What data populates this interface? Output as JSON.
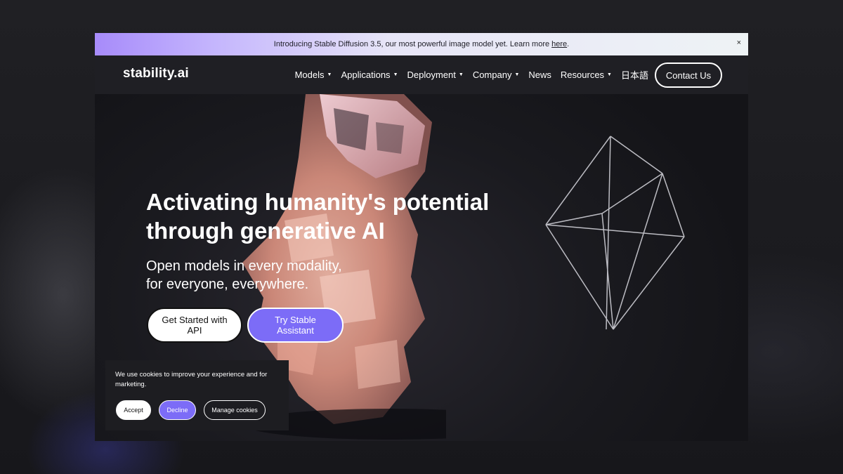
{
  "announcement": {
    "text": "Introducing Stable Diffusion 3.5, our most powerful image model yet. Learn more",
    "link": "here",
    "period": ".",
    "close": "×"
  },
  "nav": {
    "logo": "stability.ai",
    "items": [
      {
        "label": "Models",
        "caret": "▼"
      },
      {
        "label": "Applications",
        "caret": "▼"
      },
      {
        "label": "Deployment",
        "caret": "▼"
      },
      {
        "label": "Company",
        "caret": "▼"
      },
      {
        "label": "News",
        "caret": ""
      },
      {
        "label": "Resources",
        "caret": "▼"
      },
      {
        "label": "日本語",
        "caret": ""
      }
    ],
    "contact": "Contact Us"
  },
  "hero": {
    "title": "Activating humanity's potential through generative AI",
    "subtitle_line1": "Open models in every modality,",
    "subtitle_line2": "for everyone, everywhere.",
    "cta_api": "Get Started with API",
    "cta_assistant": "Try Stable Assistant"
  },
  "cookie": {
    "text": "We use cookies to improve your experience and for marketing.",
    "accept": "Accept",
    "decline": "Decline",
    "manage": "Manage cookies"
  },
  "colors": {
    "accent": "#7c6cf7",
    "nav_bg": "#1f1f24",
    "hero_bg": "#1a1a1f"
  }
}
